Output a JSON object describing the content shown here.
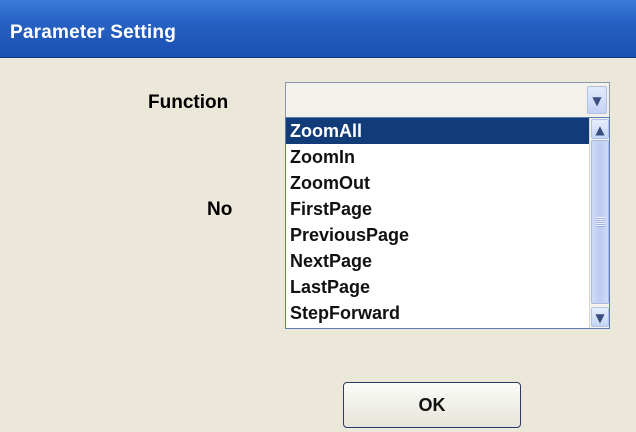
{
  "window": {
    "title": "Parameter Setting"
  },
  "form": {
    "function_label": "Function",
    "function_value": "",
    "no_label": "No"
  },
  "dropdown": {
    "open": true,
    "selected": "ZoomAll",
    "visible_options": [
      "ZoomAll",
      "ZoomIn",
      "ZoomOut",
      "FirstPage",
      "PreviousPage",
      "NextPage",
      "LastPage",
      "StepForward"
    ]
  },
  "buttons": {
    "ok_label": "OK"
  },
  "icons": {
    "combo_arrow": "chevron-down-icon",
    "scroll_up": "chevron-up-icon",
    "scroll_down": "chevron-down-icon"
  },
  "colors": {
    "titlebar": "#2761c4",
    "selection": "#123c78",
    "background": "#ebe8d9"
  }
}
